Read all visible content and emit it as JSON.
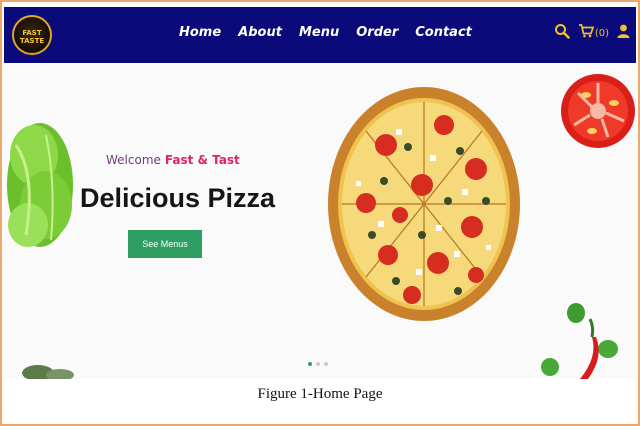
{
  "logo": {
    "text": "FAST TASTE"
  },
  "nav": {
    "items": [
      {
        "label": "Home"
      },
      {
        "label": "About"
      },
      {
        "label": "Menu"
      },
      {
        "label": "Order"
      },
      {
        "label": "Contact"
      }
    ]
  },
  "header_icons": {
    "search": "search-icon",
    "cart": "cart-icon",
    "cart_count": "(0)",
    "user": "user-icon"
  },
  "hero": {
    "welcome_text": "Welcome",
    "brand_text": "Fast & Tast",
    "title": "Delicious Pizza",
    "button_label": "See Menus"
  },
  "carousel": {
    "slides": 3,
    "active_index": 0
  },
  "caption": "Figure 1-Home Page",
  "colors": {
    "navbar": "#0a0a7a",
    "accent_yellow": "#f2c12e",
    "brand_pink": "#e0246a",
    "button_green": "#2f9e63",
    "frame_border": "#f0a56a"
  }
}
